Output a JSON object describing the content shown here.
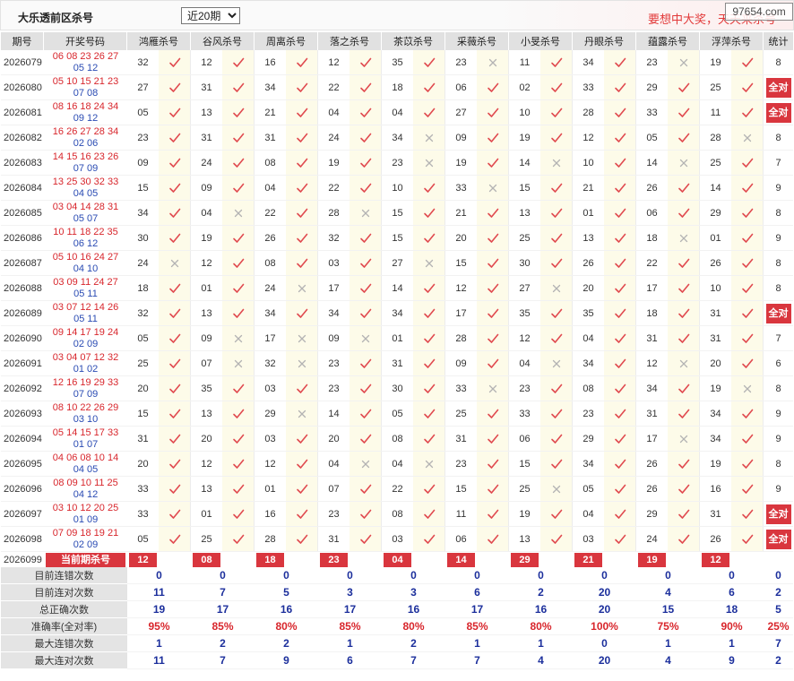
{
  "header": {
    "title": "大乐透前区杀号",
    "period_select": {
      "value": "近20期"
    },
    "slogan": "要想中大奖，天天来杀号",
    "watermark": "97654.com"
  },
  "colors": {
    "accent_red": "#d9363e",
    "draw_red": "#d8262c",
    "draw_blue": "#2a4bb3",
    "check_red": "#e04a4f",
    "cross_gray": "#b3b3b3",
    "stat_blue": "#1c2f9c",
    "slogan_red": "#e23a3a"
  },
  "icons": {
    "correct": "check-icon",
    "wrong": "cross-icon"
  },
  "table": {
    "columns": {
      "period": "期号",
      "draw": "开奖号码",
      "experts": [
        "鸿雁杀号",
        "谷风杀号",
        "周离杀号",
        "落之杀号",
        "茶苡杀号",
        "采薇杀号",
        "小旻杀号",
        "丹眼杀号",
        "蕴露杀号",
        "浮萍杀号"
      ],
      "stats": "统计"
    },
    "rows": [
      {
        "period": "2026079",
        "front": "06 08 23 26 27",
        "back": "05 12",
        "kills": [
          "32",
          "12",
          "16",
          "12",
          "35",
          "23",
          "11",
          "34",
          "23",
          "19"
        ],
        "correct": [
          1,
          1,
          1,
          1,
          1,
          0,
          1,
          1,
          0,
          1
        ],
        "stat": "8"
      },
      {
        "period": "2026080",
        "front": "05 10 15 21 23",
        "back": "07 08",
        "kills": [
          "27",
          "31",
          "34",
          "22",
          "18",
          "06",
          "02",
          "33",
          "29",
          "25"
        ],
        "correct": [
          1,
          1,
          1,
          1,
          1,
          1,
          1,
          1,
          1,
          1
        ],
        "stat": "全对"
      },
      {
        "period": "2026081",
        "front": "08 16 18 24 34",
        "back": "09 12",
        "kills": [
          "05",
          "13",
          "21",
          "04",
          "04",
          "27",
          "10",
          "28",
          "33",
          "11"
        ],
        "correct": [
          1,
          1,
          1,
          1,
          1,
          1,
          1,
          1,
          1,
          1
        ],
        "stat": "全对"
      },
      {
        "period": "2026082",
        "front": "16 26 27 28 34",
        "back": "02 06",
        "kills": [
          "23",
          "31",
          "31",
          "24",
          "34",
          "09",
          "19",
          "12",
          "05",
          "28"
        ],
        "correct": [
          1,
          1,
          1,
          1,
          0,
          1,
          1,
          1,
          1,
          0
        ],
        "stat": "8"
      },
      {
        "period": "2026083",
        "front": "14 15 16 23 26",
        "back": "07 09",
        "kills": [
          "09",
          "24",
          "08",
          "19",
          "23",
          "19",
          "14",
          "10",
          "14",
          "25"
        ],
        "correct": [
          1,
          1,
          1,
          1,
          0,
          1,
          0,
          1,
          0,
          1
        ],
        "stat": "7"
      },
      {
        "period": "2026084",
        "front": "13 25 30 32 33",
        "back": "04 05",
        "kills": [
          "15",
          "09",
          "04",
          "22",
          "10",
          "33",
          "15",
          "21",
          "26",
          "14"
        ],
        "correct": [
          1,
          1,
          1,
          1,
          1,
          0,
          1,
          1,
          1,
          1
        ],
        "stat": "9"
      },
      {
        "period": "2026085",
        "front": "03 04 14 28 31",
        "back": "05 07",
        "kills": [
          "34",
          "04",
          "22",
          "28",
          "15",
          "21",
          "13",
          "01",
          "06",
          "29"
        ],
        "correct": [
          1,
          0,
          1,
          0,
          1,
          1,
          1,
          1,
          1,
          1
        ],
        "stat": "8"
      },
      {
        "period": "2026086",
        "front": "10 11 18 22 35",
        "back": "06 12",
        "kills": [
          "30",
          "19",
          "26",
          "32",
          "15",
          "20",
          "25",
          "13",
          "18",
          "01"
        ],
        "correct": [
          1,
          1,
          1,
          1,
          1,
          1,
          1,
          1,
          0,
          1
        ],
        "stat": "9"
      },
      {
        "period": "2026087",
        "front": "05 10 16 24 27",
        "back": "04 10",
        "kills": [
          "24",
          "12",
          "08",
          "03",
          "27",
          "15",
          "30",
          "26",
          "22",
          "26"
        ],
        "correct": [
          0,
          1,
          1,
          1,
          0,
          1,
          1,
          1,
          1,
          1
        ],
        "stat": "8"
      },
      {
        "period": "2026088",
        "front": "03 09 11 24 27",
        "back": "05 11",
        "kills": [
          "18",
          "01",
          "24",
          "17",
          "14",
          "12",
          "27",
          "20",
          "17",
          "10"
        ],
        "correct": [
          1,
          1,
          0,
          1,
          1,
          1,
          0,
          1,
          1,
          1
        ],
        "stat": "8"
      },
      {
        "period": "2026089",
        "front": "03 07 12 14 26",
        "back": "05 11",
        "kills": [
          "32",
          "13",
          "34",
          "34",
          "34",
          "17",
          "35",
          "35",
          "18",
          "31"
        ],
        "correct": [
          1,
          1,
          1,
          1,
          1,
          1,
          1,
          1,
          1,
          1
        ],
        "stat": "全对"
      },
      {
        "period": "2026090",
        "front": "09 14 17 19 24",
        "back": "02 09",
        "kills": [
          "05",
          "09",
          "17",
          "09",
          "01",
          "28",
          "12",
          "04",
          "31",
          "31"
        ],
        "correct": [
          1,
          0,
          0,
          0,
          1,
          1,
          1,
          1,
          1,
          1
        ],
        "stat": "7"
      },
      {
        "period": "2026091",
        "front": "03 04 07 12 32",
        "back": "01 02",
        "kills": [
          "25",
          "07",
          "32",
          "23",
          "31",
          "09",
          "04",
          "34",
          "12",
          "20"
        ],
        "correct": [
          1,
          0,
          0,
          1,
          1,
          1,
          0,
          1,
          0,
          1
        ],
        "stat": "6"
      },
      {
        "period": "2026092",
        "front": "12 16 19 29 33",
        "back": "07 09",
        "kills": [
          "20",
          "35",
          "03",
          "23",
          "30",
          "33",
          "23",
          "08",
          "34",
          "19"
        ],
        "correct": [
          1,
          1,
          1,
          1,
          1,
          0,
          1,
          1,
          1,
          0
        ],
        "stat": "8"
      },
      {
        "period": "2026093",
        "front": "08 10 22 26 29",
        "back": "03 10",
        "kills": [
          "15",
          "13",
          "29",
          "14",
          "05",
          "25",
          "33",
          "23",
          "31",
          "34"
        ],
        "correct": [
          1,
          1,
          0,
          1,
          1,
          1,
          1,
          1,
          1,
          1
        ],
        "stat": "9"
      },
      {
        "period": "2026094",
        "front": "05 14 15 17 33",
        "back": "01 07",
        "kills": [
          "31",
          "20",
          "03",
          "20",
          "08",
          "31",
          "06",
          "29",
          "17",
          "34"
        ],
        "correct": [
          1,
          1,
          1,
          1,
          1,
          1,
          1,
          1,
          0,
          1
        ],
        "stat": "9"
      },
      {
        "period": "2026095",
        "front": "04 06 08 10 14",
        "back": "04 05",
        "kills": [
          "20",
          "12",
          "12",
          "04",
          "04",
          "23",
          "15",
          "34",
          "26",
          "19"
        ],
        "correct": [
          1,
          1,
          1,
          0,
          0,
          1,
          1,
          1,
          1,
          1
        ],
        "stat": "8"
      },
      {
        "period": "2026096",
        "front": "08 09 10 11 25",
        "back": "04 12",
        "kills": [
          "33",
          "13",
          "01",
          "07",
          "22",
          "15",
          "25",
          "05",
          "26",
          "16"
        ],
        "correct": [
          1,
          1,
          1,
          1,
          1,
          1,
          0,
          1,
          1,
          1
        ],
        "stat": "9"
      },
      {
        "period": "2026097",
        "front": "03 10 12 20 25",
        "back": "01 09",
        "kills": [
          "33",
          "01",
          "16",
          "23",
          "08",
          "11",
          "19",
          "04",
          "29",
          "31"
        ],
        "correct": [
          1,
          1,
          1,
          1,
          1,
          1,
          1,
          1,
          1,
          1
        ],
        "stat": "全对"
      },
      {
        "period": "2026098",
        "front": "07 09 18 19 21",
        "back": "02 09",
        "kills": [
          "05",
          "25",
          "28",
          "31",
          "03",
          "06",
          "13",
          "03",
          "24",
          "26"
        ],
        "correct": [
          1,
          1,
          1,
          1,
          1,
          1,
          1,
          1,
          1,
          1
        ],
        "stat": "全对"
      }
    ],
    "current": {
      "period": "2026099",
      "label": "当前期杀号",
      "kills": [
        "12",
        "08",
        "18",
        "23",
        "04",
        "14",
        "29",
        "21",
        "19",
        "12"
      ]
    },
    "summary": [
      {
        "label": "目前连错次数",
        "values": [
          "0",
          "0",
          "0",
          "0",
          "0",
          "0",
          "0",
          "0",
          "0",
          "0"
        ],
        "total": "0",
        "value_color": "#1c2f9c"
      },
      {
        "label": "目前连对次数",
        "values": [
          "11",
          "7",
          "5",
          "3",
          "3",
          "6",
          "2",
          "20",
          "4",
          "6"
        ],
        "total": "2",
        "value_color": "#1c2f9c"
      },
      {
        "label": "总正确次数",
        "values": [
          "19",
          "17",
          "16",
          "17",
          "16",
          "17",
          "16",
          "20",
          "15",
          "18"
        ],
        "total": "5",
        "value_color": "#1c2f9c"
      },
      {
        "label": "准确率(全对率)",
        "values": [
          "95%",
          "85%",
          "80%",
          "85%",
          "80%",
          "85%",
          "80%",
          "100%",
          "75%",
          "90%"
        ],
        "total": "25%",
        "value_color": "#d8262c"
      },
      {
        "label": "最大连错次数",
        "values": [
          "1",
          "2",
          "2",
          "1",
          "2",
          "1",
          "1",
          "0",
          "1",
          "1"
        ],
        "total": "7",
        "value_color": "#1c2f9c"
      },
      {
        "label": "最大连对次数",
        "values": [
          "11",
          "7",
          "9",
          "6",
          "7",
          "7",
          "4",
          "20",
          "4",
          "9"
        ],
        "total": "2",
        "value_color": "#1c2f9c"
      }
    ]
  }
}
